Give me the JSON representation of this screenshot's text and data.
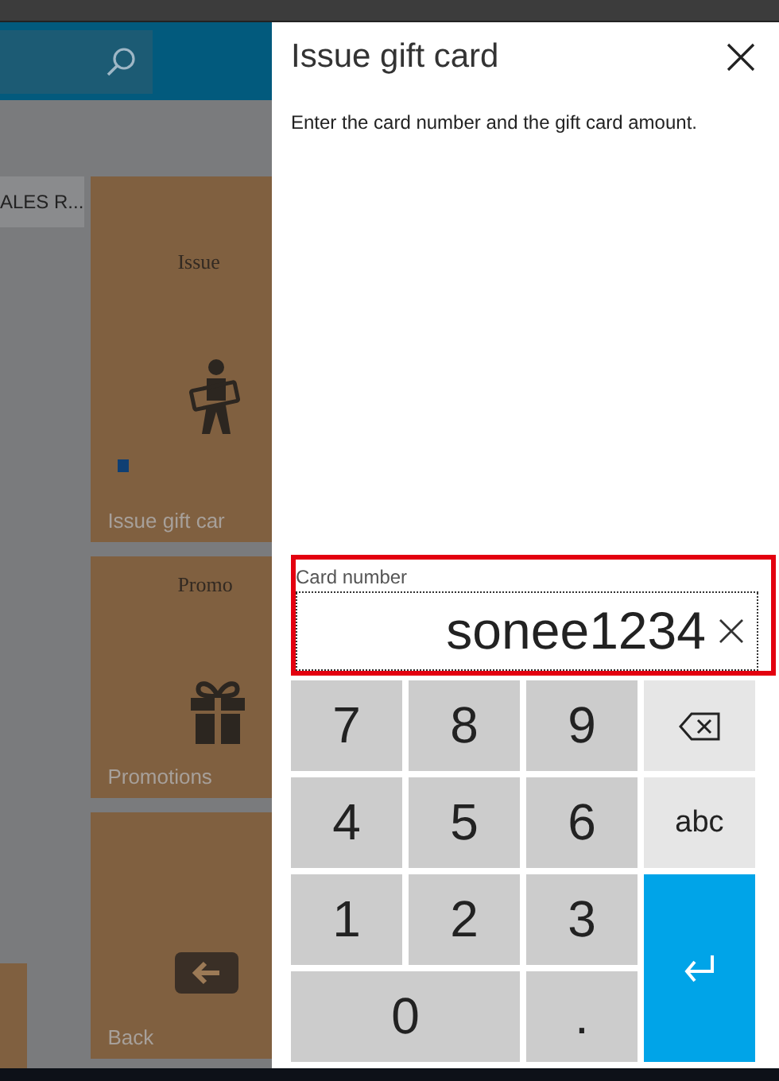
{
  "sales_tile": {
    "label": "ALES R..."
  },
  "tiles": [
    {
      "kind": "issue",
      "title": "Issue",
      "label": "Issue gift car"
    },
    {
      "kind": "promo",
      "title": "Promo",
      "label": "Promotions"
    },
    {
      "kind": "back",
      "label": "Back"
    }
  ],
  "dialog": {
    "title": "Issue gift card",
    "instruction": "Enter the card number and the gift card amount.",
    "field": {
      "label": "Card number",
      "value": "sonee1234",
      "highlighted": true
    },
    "keys": [
      {
        "kind": "digit",
        "label": "7"
      },
      {
        "kind": "digit",
        "label": "8"
      },
      {
        "kind": "digit",
        "label": "9"
      },
      {
        "kind": "backspace"
      },
      {
        "kind": "digit",
        "label": "4"
      },
      {
        "kind": "digit",
        "label": "5"
      },
      {
        "kind": "digit",
        "label": "6"
      },
      {
        "kind": "mode",
        "label": "abc"
      },
      {
        "kind": "digit",
        "label": "1"
      },
      {
        "kind": "digit",
        "label": "2"
      },
      {
        "kind": "digit",
        "label": "3"
      },
      {
        "kind": "enter"
      },
      {
        "kind": "zero",
        "label": "0"
      },
      {
        "kind": "digit",
        "label": "."
      }
    ]
  }
}
